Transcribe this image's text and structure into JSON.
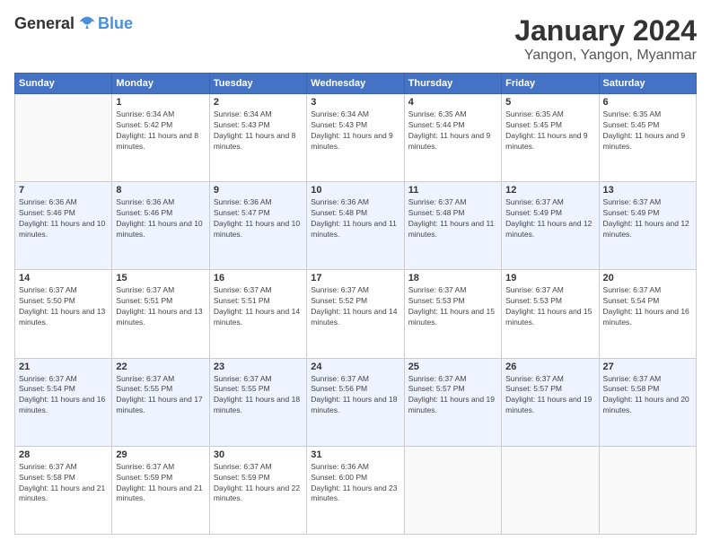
{
  "logo": {
    "general": "General",
    "blue": "Blue"
  },
  "header": {
    "month": "January 2024",
    "location": "Yangon, Yangon, Myanmar"
  },
  "weekdays": [
    "Sunday",
    "Monday",
    "Tuesday",
    "Wednesday",
    "Thursday",
    "Friday",
    "Saturday"
  ],
  "weeks": [
    [
      {
        "day": "",
        "sunrise": "",
        "sunset": "",
        "daylight": ""
      },
      {
        "day": "1",
        "sunrise": "Sunrise: 6:34 AM",
        "sunset": "Sunset: 5:42 PM",
        "daylight": "Daylight: 11 hours and 8 minutes."
      },
      {
        "day": "2",
        "sunrise": "Sunrise: 6:34 AM",
        "sunset": "Sunset: 5:43 PM",
        "daylight": "Daylight: 11 hours and 8 minutes."
      },
      {
        "day": "3",
        "sunrise": "Sunrise: 6:34 AM",
        "sunset": "Sunset: 5:43 PM",
        "daylight": "Daylight: 11 hours and 9 minutes."
      },
      {
        "day": "4",
        "sunrise": "Sunrise: 6:35 AM",
        "sunset": "Sunset: 5:44 PM",
        "daylight": "Daylight: 11 hours and 9 minutes."
      },
      {
        "day": "5",
        "sunrise": "Sunrise: 6:35 AM",
        "sunset": "Sunset: 5:45 PM",
        "daylight": "Daylight: 11 hours and 9 minutes."
      },
      {
        "day": "6",
        "sunrise": "Sunrise: 6:35 AM",
        "sunset": "Sunset: 5:45 PM",
        "daylight": "Daylight: 11 hours and 9 minutes."
      }
    ],
    [
      {
        "day": "7",
        "sunrise": "Sunrise: 6:36 AM",
        "sunset": "Sunset: 5:46 PM",
        "daylight": "Daylight: 11 hours and 10 minutes."
      },
      {
        "day": "8",
        "sunrise": "Sunrise: 6:36 AM",
        "sunset": "Sunset: 5:46 PM",
        "daylight": "Daylight: 11 hours and 10 minutes."
      },
      {
        "day": "9",
        "sunrise": "Sunrise: 6:36 AM",
        "sunset": "Sunset: 5:47 PM",
        "daylight": "Daylight: 11 hours and 10 minutes."
      },
      {
        "day": "10",
        "sunrise": "Sunrise: 6:36 AM",
        "sunset": "Sunset: 5:48 PM",
        "daylight": "Daylight: 11 hours and 11 minutes."
      },
      {
        "day": "11",
        "sunrise": "Sunrise: 6:37 AM",
        "sunset": "Sunset: 5:48 PM",
        "daylight": "Daylight: 11 hours and 11 minutes."
      },
      {
        "day": "12",
        "sunrise": "Sunrise: 6:37 AM",
        "sunset": "Sunset: 5:49 PM",
        "daylight": "Daylight: 11 hours and 12 minutes."
      },
      {
        "day": "13",
        "sunrise": "Sunrise: 6:37 AM",
        "sunset": "Sunset: 5:49 PM",
        "daylight": "Daylight: 11 hours and 12 minutes."
      }
    ],
    [
      {
        "day": "14",
        "sunrise": "Sunrise: 6:37 AM",
        "sunset": "Sunset: 5:50 PM",
        "daylight": "Daylight: 11 hours and 13 minutes."
      },
      {
        "day": "15",
        "sunrise": "Sunrise: 6:37 AM",
        "sunset": "Sunset: 5:51 PM",
        "daylight": "Daylight: 11 hours and 13 minutes."
      },
      {
        "day": "16",
        "sunrise": "Sunrise: 6:37 AM",
        "sunset": "Sunset: 5:51 PM",
        "daylight": "Daylight: 11 hours and 14 minutes."
      },
      {
        "day": "17",
        "sunrise": "Sunrise: 6:37 AM",
        "sunset": "Sunset: 5:52 PM",
        "daylight": "Daylight: 11 hours and 14 minutes."
      },
      {
        "day": "18",
        "sunrise": "Sunrise: 6:37 AM",
        "sunset": "Sunset: 5:53 PM",
        "daylight": "Daylight: 11 hours and 15 minutes."
      },
      {
        "day": "19",
        "sunrise": "Sunrise: 6:37 AM",
        "sunset": "Sunset: 5:53 PM",
        "daylight": "Daylight: 11 hours and 15 minutes."
      },
      {
        "day": "20",
        "sunrise": "Sunrise: 6:37 AM",
        "sunset": "Sunset: 5:54 PM",
        "daylight": "Daylight: 11 hours and 16 minutes."
      }
    ],
    [
      {
        "day": "21",
        "sunrise": "Sunrise: 6:37 AM",
        "sunset": "Sunset: 5:54 PM",
        "daylight": "Daylight: 11 hours and 16 minutes."
      },
      {
        "day": "22",
        "sunrise": "Sunrise: 6:37 AM",
        "sunset": "Sunset: 5:55 PM",
        "daylight": "Daylight: 11 hours and 17 minutes."
      },
      {
        "day": "23",
        "sunrise": "Sunrise: 6:37 AM",
        "sunset": "Sunset: 5:55 PM",
        "daylight": "Daylight: 11 hours and 18 minutes."
      },
      {
        "day": "24",
        "sunrise": "Sunrise: 6:37 AM",
        "sunset": "Sunset: 5:56 PM",
        "daylight": "Daylight: 11 hours and 18 minutes."
      },
      {
        "day": "25",
        "sunrise": "Sunrise: 6:37 AM",
        "sunset": "Sunset: 5:57 PM",
        "daylight": "Daylight: 11 hours and 19 minutes."
      },
      {
        "day": "26",
        "sunrise": "Sunrise: 6:37 AM",
        "sunset": "Sunset: 5:57 PM",
        "daylight": "Daylight: 11 hours and 19 minutes."
      },
      {
        "day": "27",
        "sunrise": "Sunrise: 6:37 AM",
        "sunset": "Sunset: 5:58 PM",
        "daylight": "Daylight: 11 hours and 20 minutes."
      }
    ],
    [
      {
        "day": "28",
        "sunrise": "Sunrise: 6:37 AM",
        "sunset": "Sunset: 5:58 PM",
        "daylight": "Daylight: 11 hours and 21 minutes."
      },
      {
        "day": "29",
        "sunrise": "Sunrise: 6:37 AM",
        "sunset": "Sunset: 5:59 PM",
        "daylight": "Daylight: 11 hours and 21 minutes."
      },
      {
        "day": "30",
        "sunrise": "Sunrise: 6:37 AM",
        "sunset": "Sunset: 5:59 PM",
        "daylight": "Daylight: 11 hours and 22 minutes."
      },
      {
        "day": "31",
        "sunrise": "Sunrise: 6:36 AM",
        "sunset": "Sunset: 6:00 PM",
        "daylight": "Daylight: 11 hours and 23 minutes."
      },
      {
        "day": "",
        "sunrise": "",
        "sunset": "",
        "daylight": ""
      },
      {
        "day": "",
        "sunrise": "",
        "sunset": "",
        "daylight": ""
      },
      {
        "day": "",
        "sunrise": "",
        "sunset": "",
        "daylight": ""
      }
    ]
  ]
}
